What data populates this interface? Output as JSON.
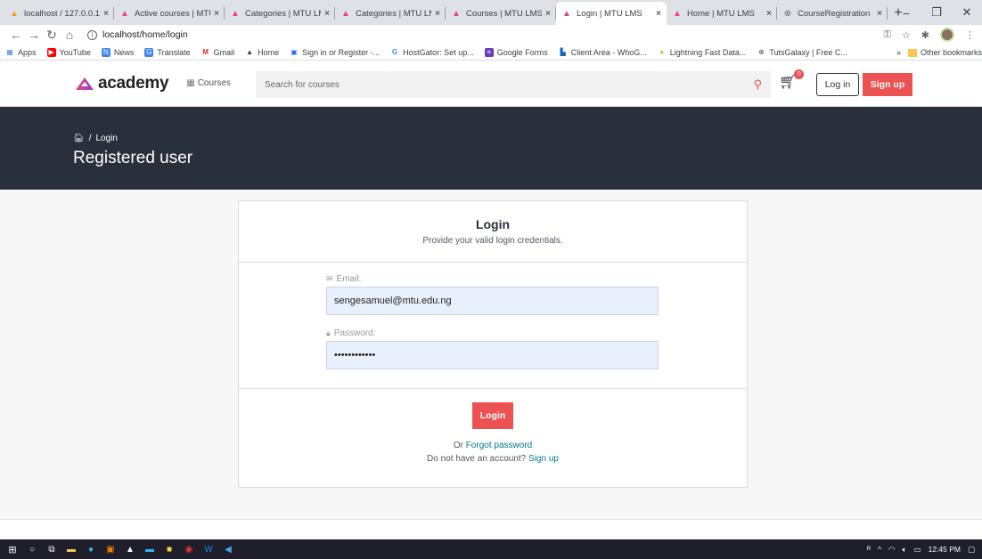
{
  "browser": {
    "tabs": [
      {
        "title": "localhost / 127.0.0.1",
        "icon": "phpmyadmin-icon",
        "color": "#f0a030"
      },
      {
        "title": "Active courses | MTU",
        "icon": "academy-icon",
        "color": "#e8457c"
      },
      {
        "title": "Categories | MTU LMS",
        "icon": "academy-icon",
        "color": "#e8457c"
      },
      {
        "title": "Categories | MTU LMS",
        "icon": "academy-icon",
        "color": "#e8457c"
      },
      {
        "title": "Courses | MTU LMS",
        "icon": "academy-icon",
        "color": "#e8457c"
      },
      {
        "title": "Login | MTU LMS",
        "icon": "academy-icon",
        "color": "#e8457c",
        "active": true
      },
      {
        "title": "Home | MTU LMS",
        "icon": "academy-icon",
        "color": "#e8457c"
      },
      {
        "title": "CourseRegistration",
        "icon": "globe-icon",
        "color": "#5f6368"
      }
    ],
    "url": "localhost/home/login",
    "bookmarks": [
      {
        "label": "Apps",
        "color": "#4285f4"
      },
      {
        "label": "YouTube",
        "color": "#ff0000"
      },
      {
        "label": "News",
        "color": "#4285f4"
      },
      {
        "label": "Translate",
        "color": "#4285f4"
      },
      {
        "label": "Gmail",
        "color": "#d93025"
      },
      {
        "label": "Home",
        "color": "#333333"
      },
      {
        "label": "Sign in or Register -...",
        "color": "#1a73e8"
      },
      {
        "label": "HostGator: Set up...",
        "color": "#4285f4"
      },
      {
        "label": "Google Forms",
        "color": "#673ab7"
      },
      {
        "label": "Client Area - WhoG...",
        "color": "#1565c0"
      },
      {
        "label": "Lightning Fast Data...",
        "color": "#f9a825"
      },
      {
        "label": "TutsGalaxy | Free C...",
        "color": "#555555"
      }
    ],
    "other_bookmarks": "Other bookmarks"
  },
  "header": {
    "logo_text": "academy",
    "courses_label": "Courses",
    "search_placeholder": "Search for courses",
    "cart_count": "0",
    "login_label": "Log in",
    "signup_label": "Sign up"
  },
  "banner": {
    "breadcrumb": "Login",
    "title": "Registered user"
  },
  "login_card": {
    "title": "Login",
    "subtitle": "Provide your valid login credentials.",
    "email_label": "Email:",
    "email_value": "sengesamuel@mtu.edu.ng",
    "password_label": "Password:",
    "password_value": "sengesamuel1",
    "submit_label": "Login",
    "or_text": "Or",
    "forgot_label": "Forgot password",
    "no_account_text": "Do not have an account?",
    "signup_link": "Sign up"
  },
  "taskbar": {
    "time": "12:45 PM"
  },
  "colors": {
    "accent": "#ec5252",
    "banner_bg": "#29303b",
    "link": "#007791"
  }
}
